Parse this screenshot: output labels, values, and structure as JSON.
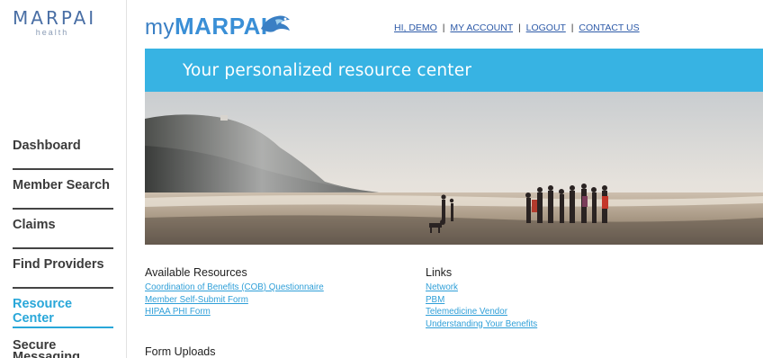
{
  "logo": {
    "main": "MARPAI",
    "sub": "health"
  },
  "sidebar": {
    "items": [
      {
        "label": "Dashboard",
        "active": false
      },
      {
        "label": "Member Search",
        "active": false
      },
      {
        "label": "Claims",
        "active": false
      },
      {
        "label": "Find Providers",
        "active": false
      },
      {
        "label": "Resource Center",
        "active": true
      },
      {
        "label": "Secure Messaging",
        "active": false
      }
    ]
  },
  "header": {
    "brand_my": "my",
    "brand_main": "MARPAI",
    "nav": {
      "greeting": "HI, DEMO",
      "account": "MY ACCOUNT",
      "logout": "LOGOUT",
      "contact": "CONTACT US",
      "separator": "|"
    }
  },
  "banner": {
    "title": "Your personalized resource center"
  },
  "resources": {
    "title": "Available Resources",
    "items": [
      "Coordination of Benefits (COB) Questionnaire",
      "Member Self-Submit Form",
      "HIPAA PHI Form"
    ]
  },
  "links": {
    "title": "Links",
    "items": [
      "Network",
      "PBM",
      "Telemedicine Vendor",
      "Understanding Your Benefits"
    ]
  },
  "uploads": {
    "title": "Form Uploads"
  },
  "colors": {
    "accent": "#37b3e3",
    "active_nav": "#29a7d9",
    "link": "#2f9fd8",
    "brand": "#3a7fc4"
  }
}
